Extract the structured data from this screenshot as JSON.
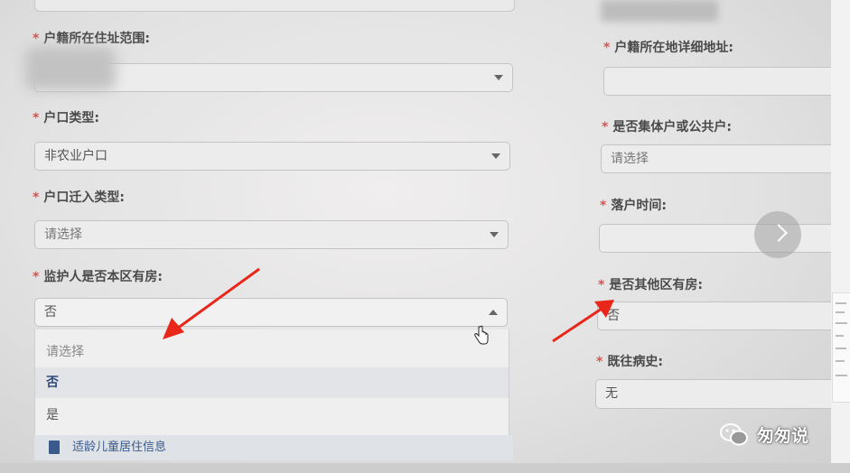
{
  "left_column": {
    "f1": {
      "label": "户籍所在住址范围:"
    },
    "f2": {
      "label": "户口类型:",
      "value": "非农业户口"
    },
    "f3": {
      "label": "户口迁入类型:",
      "value": "请选择"
    },
    "f4": {
      "label": "监护人是否本区有房:",
      "value": "否"
    }
  },
  "dropdown": {
    "options": [
      "请选择",
      "否",
      "是"
    ],
    "selected": "否"
  },
  "section_link": "适龄儿童居住信息",
  "right_column": {
    "f1": {
      "label": "户籍所在地详细地址:"
    },
    "f2": {
      "label": "是否集体户或公共户:",
      "value": "请选择"
    },
    "f3": {
      "label": "落户时间:"
    },
    "f4": {
      "label": "是否其他区有房:",
      "value": "否"
    },
    "f5": {
      "label": "既往病史:",
      "value": "无"
    }
  },
  "required_mark": "*",
  "watermark": "匆匆说",
  "colors": {
    "required": "#d9534f",
    "arrow": "#e8261a",
    "selected_text": "#2f4b7c"
  },
  "icons": [
    "chevron-down-icon",
    "chevron-up-icon",
    "next-arrow-icon",
    "document-icon",
    "hand-cursor-icon",
    "wechat-icon"
  ]
}
